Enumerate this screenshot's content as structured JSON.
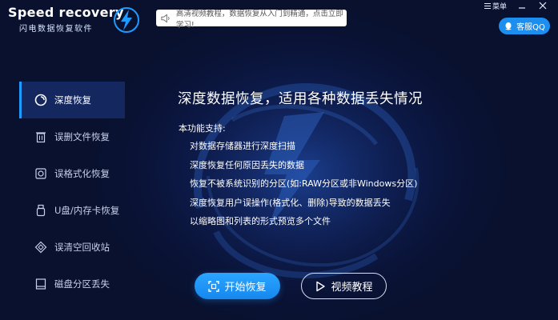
{
  "app": {
    "logo_text": "Speed recovery",
    "logo_subtitle": "闪电数据恢复软件",
    "logo_icon": "lightning-bolt-icon"
  },
  "notice": {
    "icon": "speaker-icon",
    "text": "高清视频教程，数据恢复从入门到精通，点击立即学习!"
  },
  "window_controls": {
    "menu_label": "菜单",
    "minimize_icon": "minimize-icon",
    "close_icon": "close-icon"
  },
  "support": {
    "icon": "qq-icon",
    "label": "客服QQ"
  },
  "sidebar": {
    "items": [
      {
        "label": "深度恢复",
        "icon": "deep-scan-icon",
        "active": true
      },
      {
        "label": "误删文件恢复",
        "icon": "trash-icon",
        "active": false
      },
      {
        "label": "误格式化恢复",
        "icon": "format-icon",
        "active": false
      },
      {
        "label": "U盘/内存卡恢复",
        "icon": "usb-drive-icon",
        "active": false
      },
      {
        "label": "误清空回收站",
        "icon": "recycle-icon",
        "active": false
      },
      {
        "label": "磁盘分区丢失",
        "icon": "disk-icon",
        "active": false
      }
    ]
  },
  "main": {
    "heading": "深度数据恢复，适用各种数据丢失情况",
    "intro": "本功能支持:",
    "features": [
      "对数据存储器进行深度扫描",
      "深度恢复任何原因丢失的数据",
      "恢复不被系统识别的分区(如:RAW分区或非Windows分区)",
      "深度恢复用户误操作(格式化、删除)导致的数据丢失",
      "以缩略图和列表的形式预览多个文件"
    ],
    "start_button": "开始恢复",
    "video_button": "视频教程"
  },
  "colors": {
    "accent": "#1e9bff",
    "background": "#0b1437",
    "sidebar_active": "#14275f"
  }
}
